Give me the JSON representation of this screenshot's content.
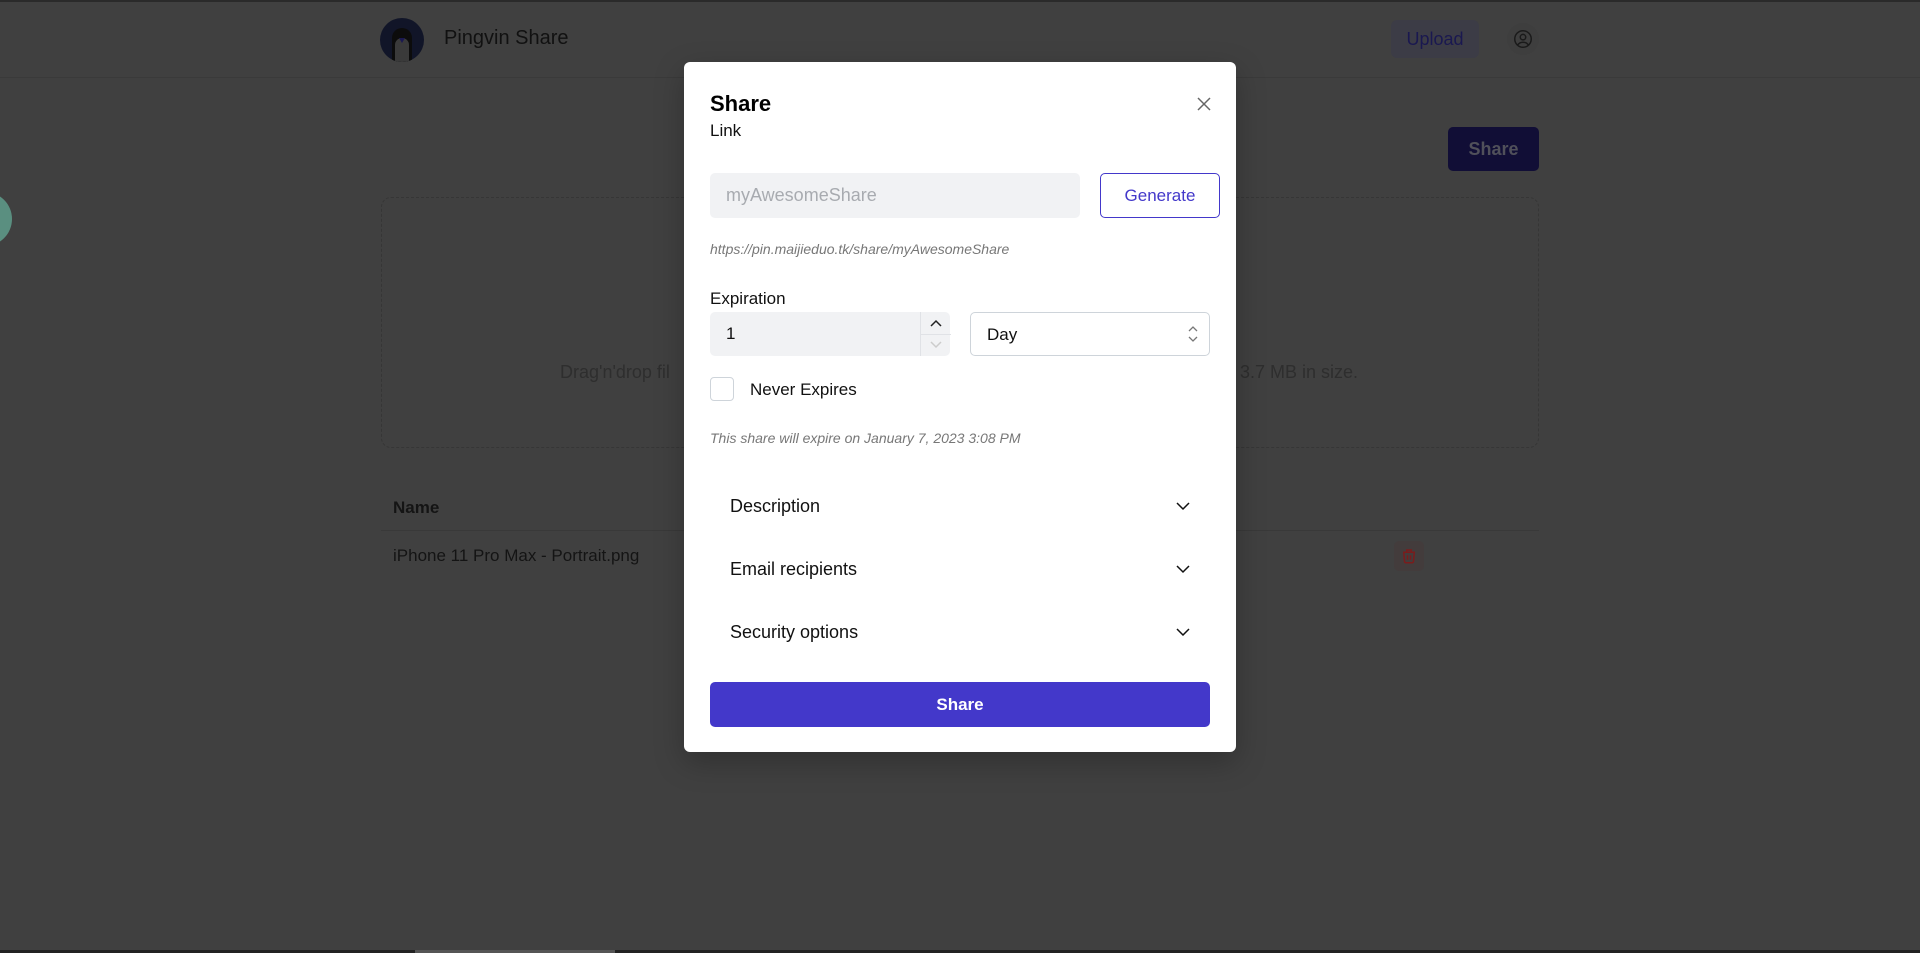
{
  "header": {
    "app_title": "Pingvin Share",
    "upload_label": "Upload",
    "logo_icon": "penguin-logo",
    "avatar_icon": "user-circle-icon"
  },
  "page": {
    "share_button_label": "Share",
    "dropzone_text_left": "Drag'n'drop fil",
    "dropzone_text_right": "3.7 MB in size.",
    "table": {
      "columns": [
        "Name"
      ],
      "rows": [
        {
          "name": "iPhone 11 Pro Max - Portrait.png"
        }
      ]
    }
  },
  "modal": {
    "title": "Share",
    "link_label": "Link",
    "link_placeholder": "myAwesomeShare",
    "generate_label": "Generate",
    "link_preview": "https://pin.maijieduo.tk/share/myAwesomeShare",
    "expiration_label": "Expiration",
    "expiration_value": "1",
    "expiration_unit": "Day",
    "never_expires_label": "Never Expires",
    "never_expires_checked": false,
    "expire_note": "This share will expire on January 7, 2023 3:08 PM",
    "sections": [
      {
        "label": "Description"
      },
      {
        "label": "Email recipients"
      },
      {
        "label": "Security options"
      }
    ],
    "submit_label": "Share"
  },
  "colors": {
    "accent": "#4338ca",
    "danger": "#e03131",
    "overlay": "rgba(0,0,0,0.75)"
  }
}
